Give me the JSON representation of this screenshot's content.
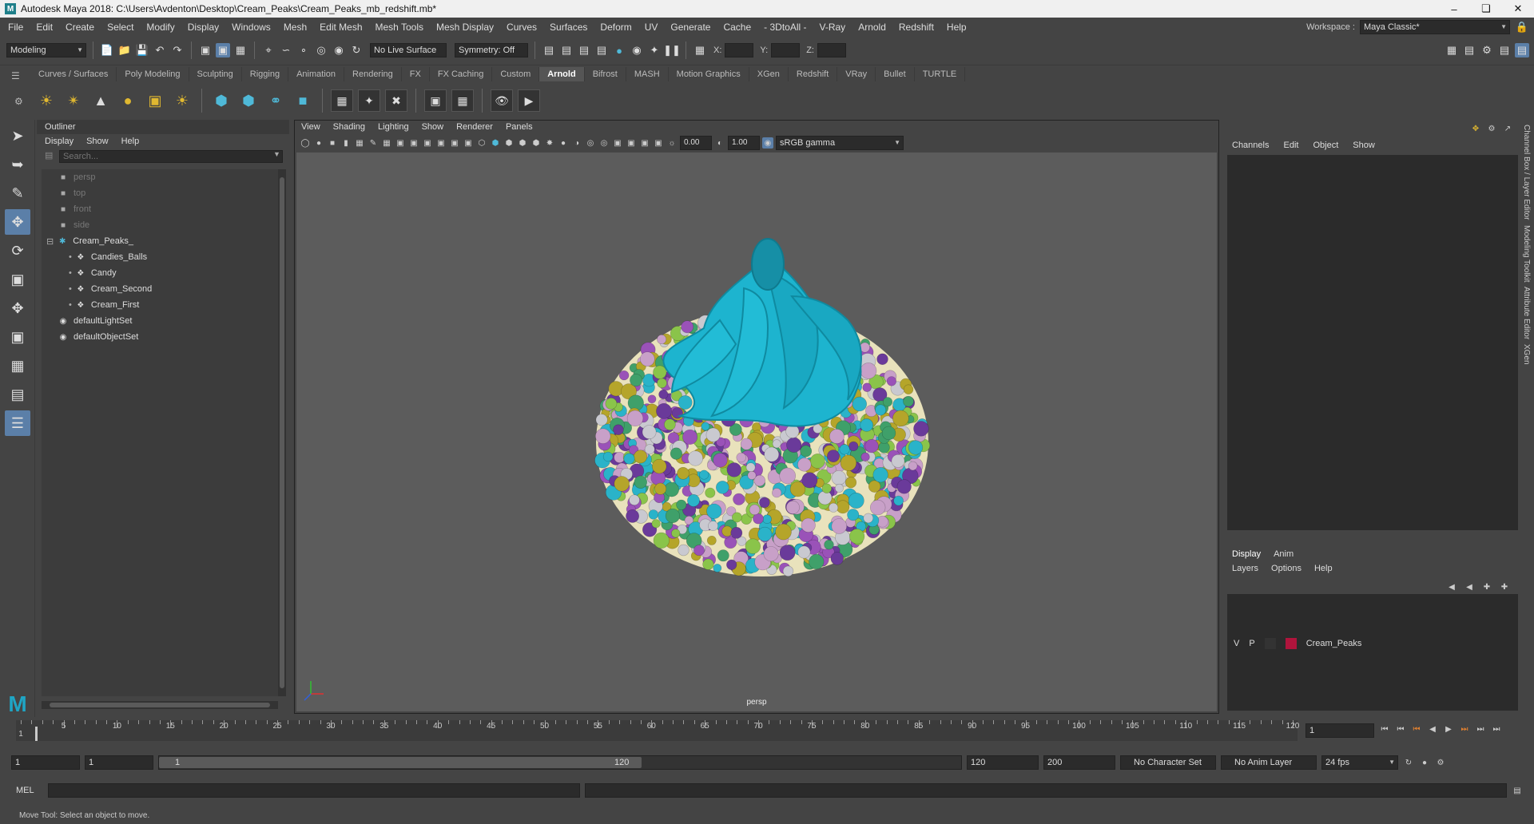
{
  "app": {
    "title": "Autodesk Maya 2018: C:\\Users\\Avdenton\\Desktop\\Cream_Peaks\\Cream_Peaks_mb_redshift.mb*"
  },
  "menubar": {
    "items": [
      "File",
      "Edit",
      "Create",
      "Select",
      "Modify",
      "Display",
      "Windows",
      "Mesh",
      "Edit Mesh",
      "Mesh Tools",
      "Mesh Display",
      "Curves",
      "Surfaces",
      "Deform",
      "UV",
      "Generate",
      "Cache",
      "- 3DtoAll -",
      "V-Ray",
      "Arnold",
      "Redshift",
      "Help"
    ],
    "workspace_label": "Workspace :",
    "workspace_value": "Maya Classic*"
  },
  "statusline": {
    "mode": "Modeling",
    "live_surface": "No Live Surface",
    "symmetry": "Symmetry: Off",
    "x_label": "X:",
    "y_label": "Y:",
    "z_label": "Z:"
  },
  "shelf": {
    "tabs": [
      "Curves / Surfaces",
      "Poly Modeling",
      "Sculpting",
      "Rigging",
      "Animation",
      "Rendering",
      "FX",
      "FX Caching",
      "Custom",
      "Arnold",
      "Bifrost",
      "MASH",
      "Motion Graphics",
      "XGen",
      "Redshift",
      "VRay",
      "Bullet",
      "TURTLE"
    ],
    "active_tab": "Arnold"
  },
  "outliner": {
    "title": "Outliner",
    "menu": [
      "Display",
      "Show",
      "Help"
    ],
    "search_placeholder": "Search...",
    "items": [
      {
        "label": "persp",
        "icon": "camera-icon",
        "indent": 1,
        "dim": true
      },
      {
        "label": "top",
        "icon": "camera-icon",
        "indent": 1,
        "dim": true
      },
      {
        "label": "front",
        "icon": "camera-icon",
        "indent": 1,
        "dim": true
      },
      {
        "label": "side",
        "icon": "camera-icon",
        "indent": 1,
        "dim": true
      },
      {
        "label": "Cream_Peaks_",
        "icon": "group-icon",
        "indent": 0,
        "dim": false,
        "expanded": true
      },
      {
        "label": "Candies_Balls",
        "icon": "mesh-icon",
        "indent": 2,
        "dim": false
      },
      {
        "label": "Candy",
        "icon": "mesh-icon",
        "indent": 2,
        "dim": false
      },
      {
        "label": "Cream_Second",
        "icon": "mesh-icon",
        "indent": 2,
        "dim": false
      },
      {
        "label": "Cream_First",
        "icon": "mesh-icon",
        "indent": 2,
        "dim": false
      },
      {
        "label": "defaultLightSet",
        "icon": "set-icon",
        "indent": 1,
        "dim": false
      },
      {
        "label": "defaultObjectSet",
        "icon": "set-icon",
        "indent": 1,
        "dim": false
      }
    ]
  },
  "viewport": {
    "menu": [
      "View",
      "Shading",
      "Lighting",
      "Show",
      "Renderer",
      "Panels"
    ],
    "exposure": "0.00",
    "gamma": "1.00",
    "color_space": "sRGB gamma",
    "camera": "persp"
  },
  "channelbox": {
    "menu": [
      "Channels",
      "Edit",
      "Object",
      "Show"
    ]
  },
  "layereditor": {
    "tabs": [
      "Display",
      "Anim"
    ],
    "active_tab": "Display",
    "menu": [
      "Layers",
      "Options",
      "Help"
    ],
    "layers": [
      {
        "v": "V",
        "p": "P",
        "name": "Cream_Peaks",
        "color": "#b0143c"
      }
    ]
  },
  "sidetabs": [
    "Channel Box / Layer Editor",
    "Modeling Toolkit",
    "Attribute Editor",
    "XGen"
  ],
  "timeslider": {
    "ticks": [
      "5",
      "10",
      "15",
      "20",
      "25",
      "30",
      "35",
      "40",
      "45",
      "50",
      "55",
      "60",
      "65",
      "70",
      "75",
      "80",
      "85",
      "90",
      "95",
      "100",
      "105",
      "110",
      "115",
      "120"
    ],
    "current_frame_marker": "1",
    "current_frame": "1"
  },
  "rangebar": {
    "start": "1",
    "playback_start": "1",
    "range_start": "1",
    "range_end": "120",
    "playback_end": "120",
    "end": "200",
    "character_set": "No Character Set",
    "anim_layer": "No Anim Layer",
    "fps": "24 fps"
  },
  "cmdline": {
    "label": "MEL"
  },
  "helpline": {
    "text": "Move Tool: Select an object to move."
  },
  "colors": {
    "accent": "#5b7fa8",
    "cream": "#1db4cf",
    "layer": "#b0143c"
  }
}
